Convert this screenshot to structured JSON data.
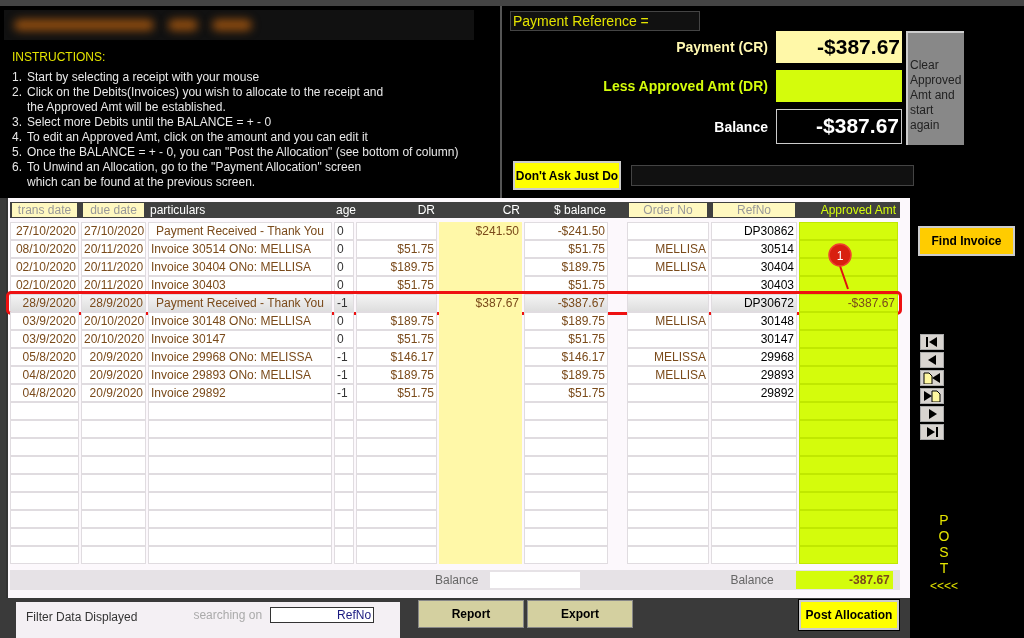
{
  "instructions": {
    "title": "INSTRUCTIONS:",
    "items": [
      {
        "number": "1.",
        "lines": [
          "Start by selecting a receipt with your mouse"
        ]
      },
      {
        "number": "2.",
        "lines": [
          "Click on the Debits(Invoices) you wish to allocate to the receipt and",
          "the Approved Amt will be established."
        ]
      },
      {
        "number": "3.",
        "lines": [
          "Select more Debits until the BALANCE = + - 0"
        ]
      },
      {
        "number": "4.",
        "lines": [
          "To edit an Approved Amt, click on the amount and you can edit it"
        ]
      },
      {
        "number": "5.",
        "lines": [
          "Once the BALANCE = + - 0, you can \"Post the Allocation\" (see bottom of column)"
        ]
      },
      {
        "number": "6.",
        "lines": [
          "To Unwind an Allocation, go to the \"Payment Allocation\" screen",
          "which can be found at the previous screen."
        ]
      }
    ]
  },
  "payment": {
    "reference_label": "Payment Reference =",
    "payment_label": "Payment (CR)",
    "payment_value": "-$387.67",
    "approved_label": "Less Approved Amt (DR)",
    "balance_label": "Balance",
    "balance_value": "-$387.67",
    "clear_button": "Clear Approved Amt and start again",
    "dont_ask_button": "Don't Ask Just Do"
  },
  "table": {
    "columns": [
      {
        "label": "trans date",
        "kind": "boxed"
      },
      {
        "label": "due date",
        "kind": "boxed"
      },
      {
        "label": "particulars",
        "kind": "plain"
      },
      {
        "label": "age",
        "kind": "plain"
      },
      {
        "label": "DR",
        "kind": "plain"
      },
      {
        "label": "CR",
        "kind": "plain"
      },
      {
        "label": "$ balance",
        "kind": "plain"
      },
      {
        "label": "Order No",
        "kind": "boxed"
      },
      {
        "label": "RefNo",
        "kind": "boxed"
      },
      {
        "label": "Approved Amt",
        "kind": "accent"
      }
    ],
    "rows": [
      {
        "kind": "payment",
        "selected": false,
        "cells": [
          "27/10/2020",
          "27/10/2020",
          "Payment Received - Thank You",
          "0",
          "",
          "$241.50",
          "-$241.50",
          "",
          "DP30862",
          ""
        ]
      },
      {
        "kind": "invoice",
        "selected": false,
        "cells": [
          "08/10/2020",
          "20/11/2020",
          "Invoice 30514 ONo: MELLISA",
          "0",
          "$51.75",
          "",
          "$51.75",
          "MELLISA",
          "30514",
          ""
        ]
      },
      {
        "kind": "invoice",
        "selected": false,
        "cells": [
          "02/10/2020",
          "20/11/2020",
          "Invoice 30404 ONo: MELLISA",
          "0",
          "$189.75",
          "",
          "$189.75",
          "MELLISA",
          "30404",
          ""
        ]
      },
      {
        "kind": "invoice",
        "selected": false,
        "cells": [
          "02/10/2020",
          "20/11/2020",
          "Invoice 30403",
          "0",
          "$51.75",
          "",
          "$51.75",
          "",
          "30403",
          ""
        ]
      },
      {
        "kind": "payment",
        "selected": true,
        "cells": [
          "28/9/2020",
          "28/9/2020",
          "Payment Received - Thank You",
          "-1",
          "",
          "$387.67",
          "-$387.67",
          "",
          "DP30672",
          "-$387.67"
        ]
      },
      {
        "kind": "invoice",
        "selected": false,
        "cells": [
          "03/9/2020",
          "20/10/2020",
          "Invoice 30148 ONo: MELLISA",
          "0",
          "$189.75",
          "",
          "$189.75",
          "MELLISA",
          "30148",
          ""
        ]
      },
      {
        "kind": "invoice",
        "selected": false,
        "cells": [
          "03/9/2020",
          "20/10/2020",
          "Invoice 30147",
          "0",
          "$51.75",
          "",
          "$51.75",
          "",
          "30147",
          ""
        ]
      },
      {
        "kind": "invoice",
        "selected": false,
        "cells": [
          "05/8/2020",
          "20/9/2020",
          "Invoice 29968 ONo: MELISSA",
          "-1",
          "$146.17",
          "",
          "$146.17",
          "MELISSA",
          "29968",
          ""
        ]
      },
      {
        "kind": "invoice",
        "selected": false,
        "cells": [
          "04/8/2020",
          "20/9/2020",
          "Invoice 29893 ONo: MELLISA",
          "-1",
          "$189.75",
          "",
          "$189.75",
          "MELLISA",
          "29893",
          ""
        ]
      },
      {
        "kind": "invoice",
        "selected": false,
        "cells": [
          "04/8/2020",
          "20/9/2020",
          "Invoice 29892",
          "-1",
          "$51.75",
          "",
          "$51.75",
          "",
          "29892",
          ""
        ]
      }
    ],
    "balance_label": "Balance",
    "approved_balance_label": "Balance",
    "approved_balance": "-387.67"
  },
  "annotation": {
    "label": "1"
  },
  "side": {
    "find_button": "Find Invoice",
    "post_letters": [
      "P",
      "O",
      "S",
      "T"
    ],
    "post_arrows": "<<<<"
  },
  "bottom": {
    "filter_label": "Filter Data Displayed",
    "searching_label": "searching on",
    "search_value": "RefNo",
    "report_button": "Report",
    "export_button": "Export",
    "post_button": "Post Allocation"
  }
}
